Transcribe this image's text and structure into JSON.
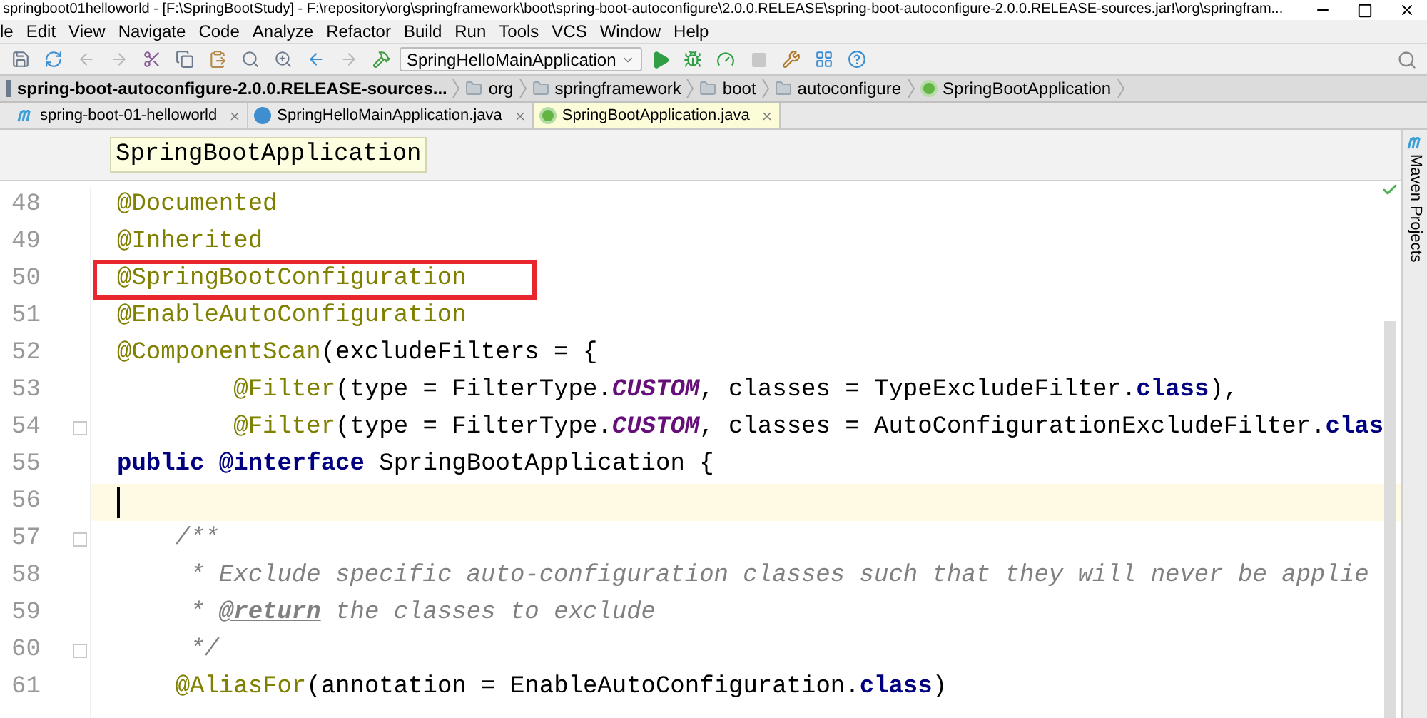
{
  "window": {
    "title": "springboot01helloworld - [F:\\SpringBootStudy] - F:\\repository\\org\\springframework\\boot\\spring-boot-autoconfigure\\2.0.0.RELEASE\\spring-boot-autoconfigure-2.0.0.RELEASE-sources.jar!\\org\\springfram..."
  },
  "menu": [
    "le",
    "Edit",
    "View",
    "Navigate",
    "Code",
    "Analyze",
    "Refactor",
    "Build",
    "Run",
    "Tools",
    "VCS",
    "Window",
    "Help"
  ],
  "toolbar": {
    "run_config": "SpringHelloMainApplication"
  },
  "breadcrumbs": [
    {
      "label": "spring-boot-autoconfigure-2.0.0.RELEASE-sources...",
      "kind": "jar"
    },
    {
      "label": "org",
      "kind": "folder"
    },
    {
      "label": "springframework",
      "kind": "folder"
    },
    {
      "label": "boot",
      "kind": "folder"
    },
    {
      "label": "autoconfigure",
      "kind": "folder"
    },
    {
      "label": "SpringBootApplication",
      "kind": "annotation"
    }
  ],
  "tabs": [
    {
      "label": "spring-boot-01-helloworld",
      "kind": "module",
      "selected": false
    },
    {
      "label": "SpringHelloMainApplication.java",
      "kind": "class",
      "selected": false
    },
    {
      "label": "SpringBootApplication.java",
      "kind": "annotation",
      "selected": true
    }
  ],
  "editor": {
    "tooltip": "SpringBootApplication",
    "lines": [
      {
        "number": "48",
        "current": false,
        "boxed": false,
        "fold": false,
        "tokens": [
          {
            "kind": "annotation",
            "text": "@Documented"
          }
        ]
      },
      {
        "number": "49",
        "current": false,
        "boxed": false,
        "fold": false,
        "tokens": [
          {
            "kind": "annotation",
            "text": "@Inherited"
          }
        ]
      },
      {
        "number": "50",
        "current": false,
        "boxed": true,
        "fold": false,
        "tokens": [
          {
            "kind": "annotation",
            "text": "@SpringBootConfiguration"
          }
        ]
      },
      {
        "number": "51",
        "current": false,
        "boxed": false,
        "fold": false,
        "tokens": [
          {
            "kind": "annotation",
            "text": "@EnableAutoConfiguration"
          }
        ]
      },
      {
        "number": "52",
        "current": false,
        "boxed": false,
        "fold": false,
        "tokens": [
          {
            "kind": "annotation",
            "text": "@ComponentScan"
          },
          {
            "kind": "plain",
            "text": "(excludeFilters = {"
          }
        ]
      },
      {
        "number": "53",
        "current": false,
        "boxed": false,
        "fold": false,
        "tokens": [
          {
            "kind": "annotation",
            "text": "        @Filter"
          },
          {
            "kind": "plain",
            "text": "(type = FilterType."
          },
          {
            "kind": "constant",
            "text": "CUSTOM"
          },
          {
            "kind": "plain",
            "text": ", classes = TypeExcludeFilter."
          },
          {
            "kind": "keyword",
            "text": "class"
          },
          {
            "kind": "plain",
            "text": "),"
          }
        ]
      },
      {
        "number": "54",
        "current": false,
        "boxed": false,
        "fold": true,
        "tokens": [
          {
            "kind": "annotation",
            "text": "        @Filter"
          },
          {
            "kind": "plain",
            "text": "(type = FilterType."
          },
          {
            "kind": "constant",
            "text": "CUSTOM"
          },
          {
            "kind": "plain",
            "text": ", classes = AutoConfigurationExcludeFilter."
          },
          {
            "kind": "keyword",
            "text": "clas"
          }
        ]
      },
      {
        "number": "55",
        "current": false,
        "boxed": false,
        "fold": false,
        "tokens": [
          {
            "kind": "keyword",
            "text": "public"
          },
          {
            "kind": "keyword",
            "text": " @interface"
          },
          {
            "kind": "plain",
            "text": " SpringBootApplication {"
          }
        ]
      },
      {
        "number": "56",
        "current": true,
        "boxed": false,
        "fold": false
      },
      {
        "number": "57",
        "current": false,
        "boxed": false,
        "fold": true,
        "tokens": [
          {
            "kind": "comment",
            "text": "    /**"
          }
        ]
      },
      {
        "number": "58",
        "current": false,
        "boxed": false,
        "fold": false,
        "tokens": [
          {
            "kind": "comment",
            "text": "     * Exclude specific auto-configuration classes such that they will never be applie"
          }
        ]
      },
      {
        "number": "59",
        "current": false,
        "boxed": false,
        "fold": false,
        "tokens": [
          {
            "kind": "comment",
            "text": "     * "
          },
          {
            "kind": "doctag",
            "text": "@return"
          },
          {
            "kind": "comment",
            "text": " the classes to exclude"
          }
        ]
      },
      {
        "number": "60",
        "current": false,
        "boxed": false,
        "fold": true,
        "tokens": [
          {
            "kind": "comment",
            "text": "     */"
          }
        ]
      },
      {
        "number": "61",
        "current": false,
        "boxed": false,
        "fold": false,
        "tokens": [
          {
            "kind": "annotation",
            "text": "    @AliasFor"
          },
          {
            "kind": "plain",
            "text": "(annotation = EnableAutoConfiguration."
          },
          {
            "kind": "keyword",
            "text": "class"
          },
          {
            "kind": "plain",
            "text": ")"
          }
        ]
      }
    ]
  },
  "side_panel": {
    "label": "Maven Projects"
  }
}
